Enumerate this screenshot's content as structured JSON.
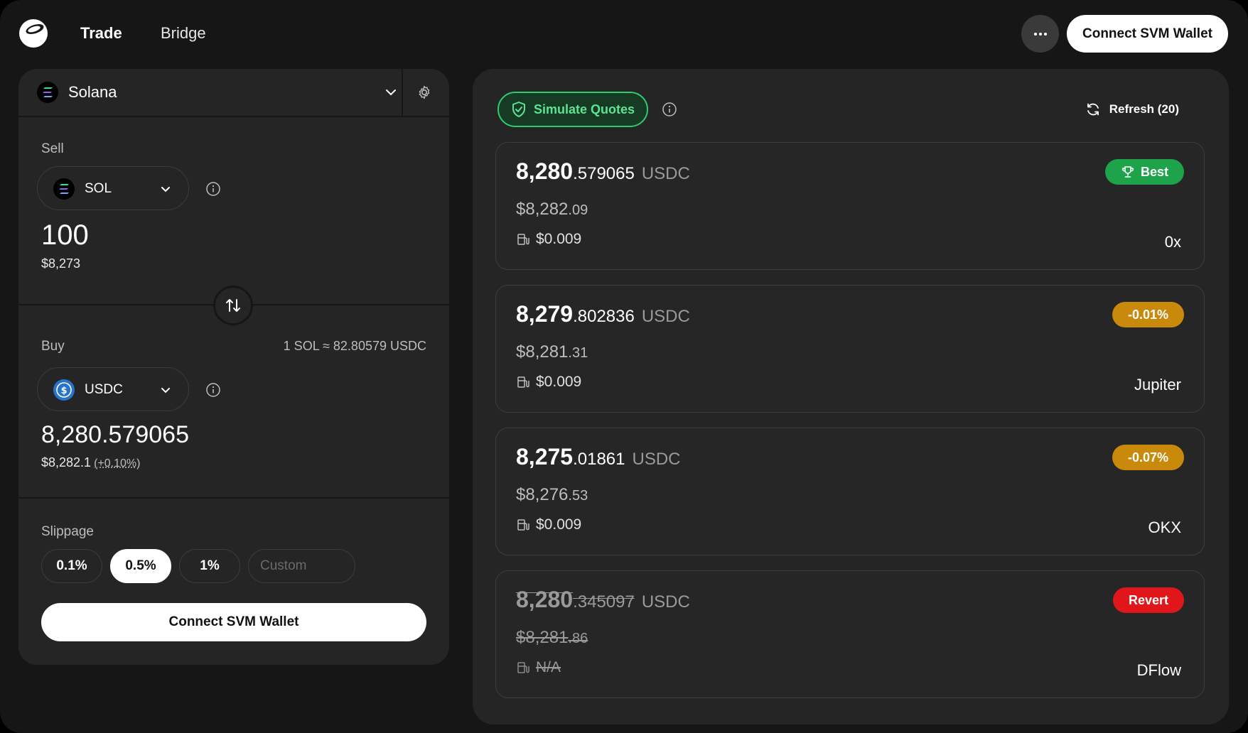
{
  "nav": {
    "tabs": [
      {
        "label": "Trade",
        "active": true
      },
      {
        "label": "Bridge",
        "active": false
      }
    ],
    "more_label": "···",
    "connect_label": "Connect SVM Wallet"
  },
  "chain": {
    "name": "Solana"
  },
  "sell": {
    "label": "Sell",
    "token": "SOL",
    "amount": "100",
    "usd": "$8,273"
  },
  "buy": {
    "label": "Buy",
    "rate": "1 SOL ≈ 82.80579 USDC",
    "token": "USDC",
    "amount": "8,280.579065",
    "usd": "$8,282.1",
    "usd_change": "(+0.10%)"
  },
  "slippage": {
    "label": "Slippage",
    "options": [
      "0.1%",
      "0.5%",
      "1%"
    ],
    "selected": "0.5%",
    "custom_placeholder": "Custom"
  },
  "connect_main_label": "Connect SVM Wallet",
  "quotes_header": {
    "simulate_label": "Simulate Quotes",
    "refresh_label": "Refresh (20)"
  },
  "quotes": [
    {
      "int": "8,280",
      "dec": ".579065",
      "unit": "USDC",
      "usd_int": "$8,282",
      "usd_dec": ".09",
      "gas": "$0.009",
      "provider": "0x",
      "badge": "Best",
      "badge_color": "#1fa34a",
      "reverted": false
    },
    {
      "int": "8,279",
      "dec": ".802836",
      "unit": "USDC",
      "usd_int": "$8,281",
      "usd_dec": ".31",
      "gas": "$0.009",
      "provider": "Jupiter",
      "badge": "-0.01%",
      "badge_color": "#c98a0b",
      "reverted": false
    },
    {
      "int": "8,275",
      "dec": ".01861",
      "unit": "USDC",
      "usd_int": "$8,276",
      "usd_dec": ".53",
      "gas": "$0.009",
      "provider": "OKX",
      "badge": "-0.07%",
      "badge_color": "#c98a0b",
      "reverted": false
    },
    {
      "int": "8,280",
      "dec": ".345097",
      "unit": "USDC",
      "usd_int": "$8,281",
      "usd_dec": ".86",
      "gas": "N/A",
      "provider": "DFlow",
      "badge": "Revert",
      "badge_color": "#e0161b",
      "reverted": true
    }
  ],
  "colors": {
    "background": "#161616",
    "panel": "#252525",
    "accent_green": "#2ecc71",
    "best_green": "#1fa34a",
    "warning_orange": "#c98a0b",
    "revert_red": "#e0161b"
  }
}
